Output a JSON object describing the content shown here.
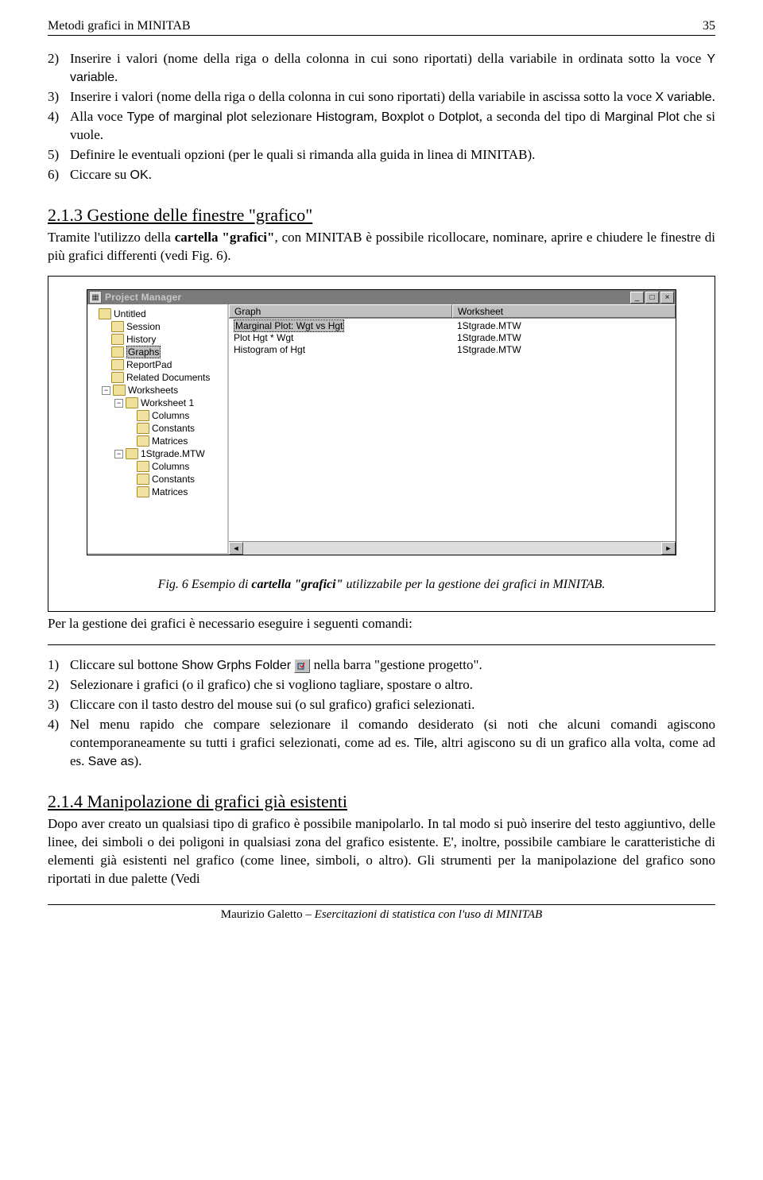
{
  "header": {
    "left": "Metodi grafici in MINITAB",
    "pageno": "35"
  },
  "list1": {
    "i2a": "Inserire i valori (nome della riga o della colonna in cui sono riportati) della variabile in ordinata sotto la voce ",
    "i2b": "Y variable",
    "i2c": ".",
    "i3a": "Inserire i valori (nome della riga o della colonna in cui sono riportati) della variabile in ascissa sotto la voce ",
    "i3b": "X variable",
    "i3c": ".",
    "i4a": "Alla voce ",
    "i4b": "Type of marginal plot",
    "i4c": " selezionare ",
    "i4d": "Histogram",
    "i4e": ", ",
    "i4f": "Boxplot",
    "i4g": " o ",
    "i4h": "Dotplot",
    "i4i": ", a seconda del tipo di ",
    "i4j": "Marginal Plot",
    "i4k": " che si vuole.",
    "i5": "Definire le eventuali opzioni (per le quali si rimanda alla guida in linea di MINITAB).",
    "i6a": "Ciccare su ",
    "i6b": "OK",
    "i6c": "."
  },
  "sec213": {
    "title": "2.1.3 Gestione delle finestre \"grafico\"",
    "p1a": "Tramite l'utilizzo della ",
    "p1b": "cartella \"grafici\"",
    "p1c": ", con MINITAB è possibile ricollocare, nominare, aprire e chiudere le finestre di più grafici differenti (vedi Fig. 6)."
  },
  "pm": {
    "title": "Project Manager",
    "colGraph": "Graph",
    "colWorksheet": "Worksheet",
    "graphs": [
      {
        "g": "Marginal Plot: Wgt vs Hgt",
        "w": "1Stgrade.MTW"
      },
      {
        "g": "Plot Hgt * Wgt",
        "w": "1Stgrade.MTW"
      },
      {
        "g": "Histogram of Hgt",
        "w": "1Stgrade.MTW"
      }
    ],
    "tree": [
      {
        "ind": 0,
        "exp": "",
        "icon": "open",
        "label": "Untitled"
      },
      {
        "ind": 1,
        "exp": "",
        "icon": "closed",
        "label": "Session"
      },
      {
        "ind": 1,
        "exp": "",
        "icon": "closed",
        "label": "History"
      },
      {
        "ind": 1,
        "exp": "",
        "icon": "open",
        "label": "Graphs"
      },
      {
        "ind": 1,
        "exp": "",
        "icon": "closed",
        "label": "ReportPad"
      },
      {
        "ind": 1,
        "exp": "",
        "icon": "closed",
        "label": "Related Documents"
      },
      {
        "ind": 1,
        "exp": "-",
        "icon": "open",
        "label": "Worksheets"
      },
      {
        "ind": 2,
        "exp": "-",
        "icon": "open",
        "label": "Worksheet 1"
      },
      {
        "ind": 3,
        "exp": "",
        "icon": "closed",
        "label": "Columns"
      },
      {
        "ind": 3,
        "exp": "",
        "icon": "closed",
        "label": "Constants"
      },
      {
        "ind": 3,
        "exp": "",
        "icon": "closed",
        "label": "Matrices"
      },
      {
        "ind": 2,
        "exp": "-",
        "icon": "open",
        "label": "1Stgrade.MTW"
      },
      {
        "ind": 3,
        "exp": "",
        "icon": "closed",
        "label": "Columns"
      },
      {
        "ind": 3,
        "exp": "",
        "icon": "closed",
        "label": "Constants"
      },
      {
        "ind": 3,
        "exp": "",
        "icon": "closed",
        "label": "Matrices"
      }
    ]
  },
  "figcap": {
    "a": "Fig. 6  Esempio di ",
    "b": "cartella \"grafici\"",
    "c": " utilizzabile per la gestione dei grafici in MINITAB."
  },
  "para2": "Per la gestione dei grafici è necessario eseguire i seguenti comandi:",
  "list2": {
    "i1a": "Cliccare sul bottone ",
    "i1b": "Show Grphs Folder",
    "i1c": " nella barra \"gestione progetto\".",
    "i2": "Selezionare i grafici (o il grafico) che si vogliono tagliare, spostare o altro.",
    "i3": "Cliccare con il tasto destro del mouse sui (o sul grafico) grafici selezionati.",
    "i4a": "Nel menu rapido che compare selezionare il comando desiderato (si noti che alcuni comandi agiscono contemporaneamente su tutti i grafici selezionati, come ad es. ",
    "i4b": "Tile",
    "i4c": ", altri agiscono su di un grafico alla volta, come ad es. ",
    "i4d": "Save as",
    "i4e": ")."
  },
  "sec214": {
    "title": "2.1.4 Manipolazione di grafici già esistenti",
    "p": "Dopo aver creato un qualsiasi tipo di grafico è possibile manipolarlo. In tal modo si può inserire del testo aggiuntivo, delle linee, dei simboli o dei poligoni in qualsiasi zona del grafico esistente. E', inoltre, possibile cambiare le caratteristiche di elementi già esistenti nel grafico (come linee, simboli, o altro). Gli strumenti per la manipolazione del grafico sono riportati in due palette (Vedi"
  },
  "footer": {
    "a": "Maurizio Galetto – ",
    "b": "Esercitazioni di statistica con l'uso di MINITAB"
  }
}
